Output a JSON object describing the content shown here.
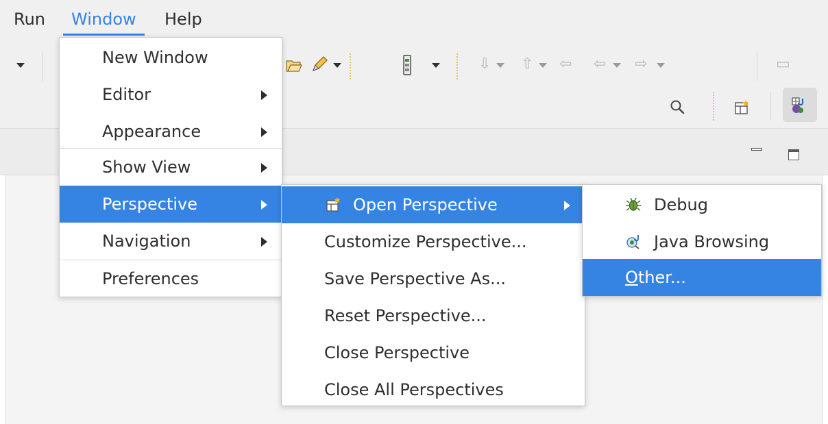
{
  "menubar": {
    "run": "Run",
    "window": "Window",
    "help": "Help"
  },
  "window_menu": {
    "items": [
      {
        "label": "New Window",
        "submenu": false
      },
      {
        "label": "Editor",
        "submenu": true
      },
      {
        "label": "Appearance",
        "submenu": true
      },
      {
        "label": "Show View",
        "submenu": true
      },
      {
        "label": "Perspective",
        "submenu": true,
        "selected": true
      },
      {
        "label": "Navigation",
        "submenu": true
      },
      {
        "label": "Preferences",
        "submenu": false
      }
    ]
  },
  "perspective_menu": {
    "items": [
      {
        "label": "Open Perspective",
        "submenu": true,
        "selected": true,
        "icon": "open-perspective-icon"
      },
      {
        "label": "Customize Perspective..."
      },
      {
        "label": "Save Perspective As..."
      },
      {
        "label": "Reset Perspective..."
      },
      {
        "label": "Close Perspective"
      },
      {
        "label": "Close All Perspectives"
      }
    ]
  },
  "open_perspective_menu": {
    "items": [
      {
        "label": "Debug",
        "icon": "debug-bug-icon"
      },
      {
        "label": "Java Browsing",
        "icon": "java-browsing-icon"
      },
      {
        "label_mnemonic": "O",
        "label_rest": "ther...",
        "selected": true
      }
    ]
  },
  "colors": {
    "accent": "#3584e4",
    "menubar_bg": "#f0f0f0",
    "text": "#2e2e2e"
  }
}
